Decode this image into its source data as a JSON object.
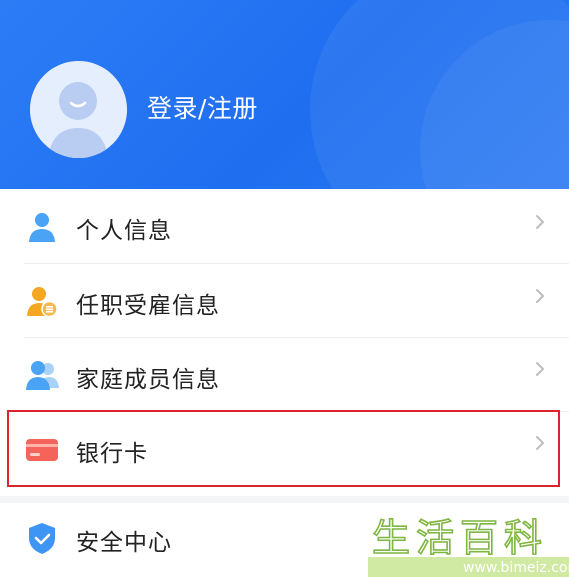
{
  "header": {
    "login_label": "登录/注册"
  },
  "menu": {
    "items": [
      {
        "label": "个人信息",
        "icon": "person-icon"
      },
      {
        "label": "任职受雇信息",
        "icon": "employment-icon"
      },
      {
        "label": "家庭成员信息",
        "icon": "family-icon"
      },
      {
        "label": "银行卡",
        "icon": "bank-card-icon"
      }
    ]
  },
  "security": {
    "label": "安全中心",
    "icon": "shield-icon"
  },
  "watermark": {
    "title": "生活百科",
    "url": "www.bimeiz.com"
  },
  "colors": {
    "header_blue": "#2472f3",
    "highlight_red": "#d9252b",
    "icon_blue": "#4aa3f5",
    "icon_orange": "#f5a623",
    "card_red": "#f4645a"
  }
}
